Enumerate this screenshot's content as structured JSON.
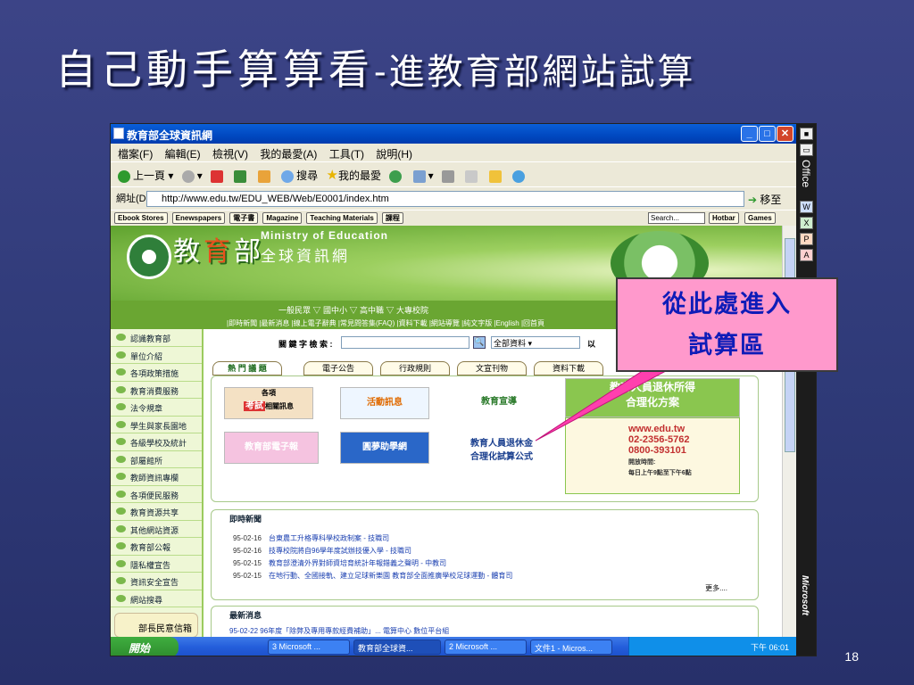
{
  "slide": {
    "title": "自己動手算算看",
    "title_sub": "-進教育部網站試算",
    "page_number": "18",
    "callout_line1": "從此處進入",
    "callout_line2": "試算區"
  },
  "window": {
    "title": "教育部全球資訊網",
    "menu": [
      "檔案(F)",
      "編輯(E)",
      "檢視(V)",
      "我的最愛(A)",
      "工具(T)",
      "說明(H)"
    ],
    "toolbar": {
      "back": "上一頁",
      "search": "搜尋",
      "favorites": "我的最愛"
    },
    "address_label": "網址(D)",
    "url": "http://www.edu.tw/EDU_WEB/Web/E0001/index.htm",
    "go_label": "移至",
    "links": [
      "Ebook Stores",
      "Enewspapers",
      "電子書",
      "Magazine",
      "Teaching Materials",
      "課程"
    ],
    "links_search_placeholder": "Search...",
    "links_right": [
      "Hotbar",
      "Games"
    ],
    "office_label": "Office",
    "microsoft_label": "Microsoft"
  },
  "site": {
    "logo_cn_1": "教",
    "logo_cn_2": "育",
    "logo_cn_3": "部",
    "logo_en": "Ministry of Education",
    "logo_sub": "全球資訊網",
    "audiences": "一般民眾 ▽ 國中小 ▽ 高中職 ▽ 大專校院",
    "quicklinks": "|即時新聞 |最新消息 |線上電子辭典 |常見問答集(FAQ) |資料下載 |網站導覽 |純文字版 |English |回首頁",
    "sidebar": [
      "認識教育部",
      "單位介紹",
      "各項政策措施",
      "教育消費服務",
      "法令規章",
      "學生與家長園地",
      "各級學校及統計",
      "部屬館所",
      "教師資訊專欄",
      "各項便民服務",
      "教育資源共享",
      "其他網站資源",
      "教育部公報",
      "隱私權宣告",
      "資訊安全宣告",
      "網站搜尋"
    ],
    "sidebar_special": "部長民意信箱",
    "keyword_label": "關 鍵 字 檢 索 :",
    "keyword_scope": "全部資料",
    "keyword_option": "以",
    "tabs": [
      "熱 門 議 題",
      "電子公告",
      "行政規則",
      "文宣刊物",
      "資料下載"
    ],
    "banners": {
      "exam_small": "各項",
      "exam": "考試",
      "exam_tail": "相關訊息",
      "activity": "活動訊息",
      "propaganda": "教育宣導",
      "retire_title": "教育人員退休所得",
      "retire_sub": "合理化方案",
      "epaper": "教育部電子報",
      "dream": "圓夢助學網",
      "calc_line1": "教育人員退休金",
      "calc_line2": "合理化試算公式",
      "info_site": "www.edu.tw",
      "info_phone1": "02-2356-5762",
      "info_phone2": "0800-393101",
      "info_hours_label": "開放時間:",
      "info_hours": "每日上午9點至下午6點"
    },
    "news_title": "即時新聞",
    "news": [
      {
        "date": "95-02-16",
        "text": "台東農工升格專科學校政制案 - 技職司"
      },
      {
        "date": "95-02-16",
        "text": "技專校院將自96學年度試辦技優入學 - 技職司"
      },
      {
        "date": "95-02-15",
        "text": "教育部澄清外界對師資培育統計年報錯義之聲明 - 中教司"
      },
      {
        "date": "95-02-15",
        "text": "在地行動、全國接軌、建立足球新樂園 教育部全面推廣學校足球運動 - 體育司"
      }
    ],
    "more": "更多....",
    "latest_title": "最新消息",
    "latest_row": "95-02-22 96年度「除弊及專用專款經費補助」... 電算中心 數位平台組"
  },
  "taskbar": {
    "start": "開始",
    "tasks": [
      "3 Microsoft ...",
      "教育部全球資...",
      "2 Microsoft ...",
      "文件1 - Micros..."
    ],
    "clock": "下午 06:01"
  }
}
